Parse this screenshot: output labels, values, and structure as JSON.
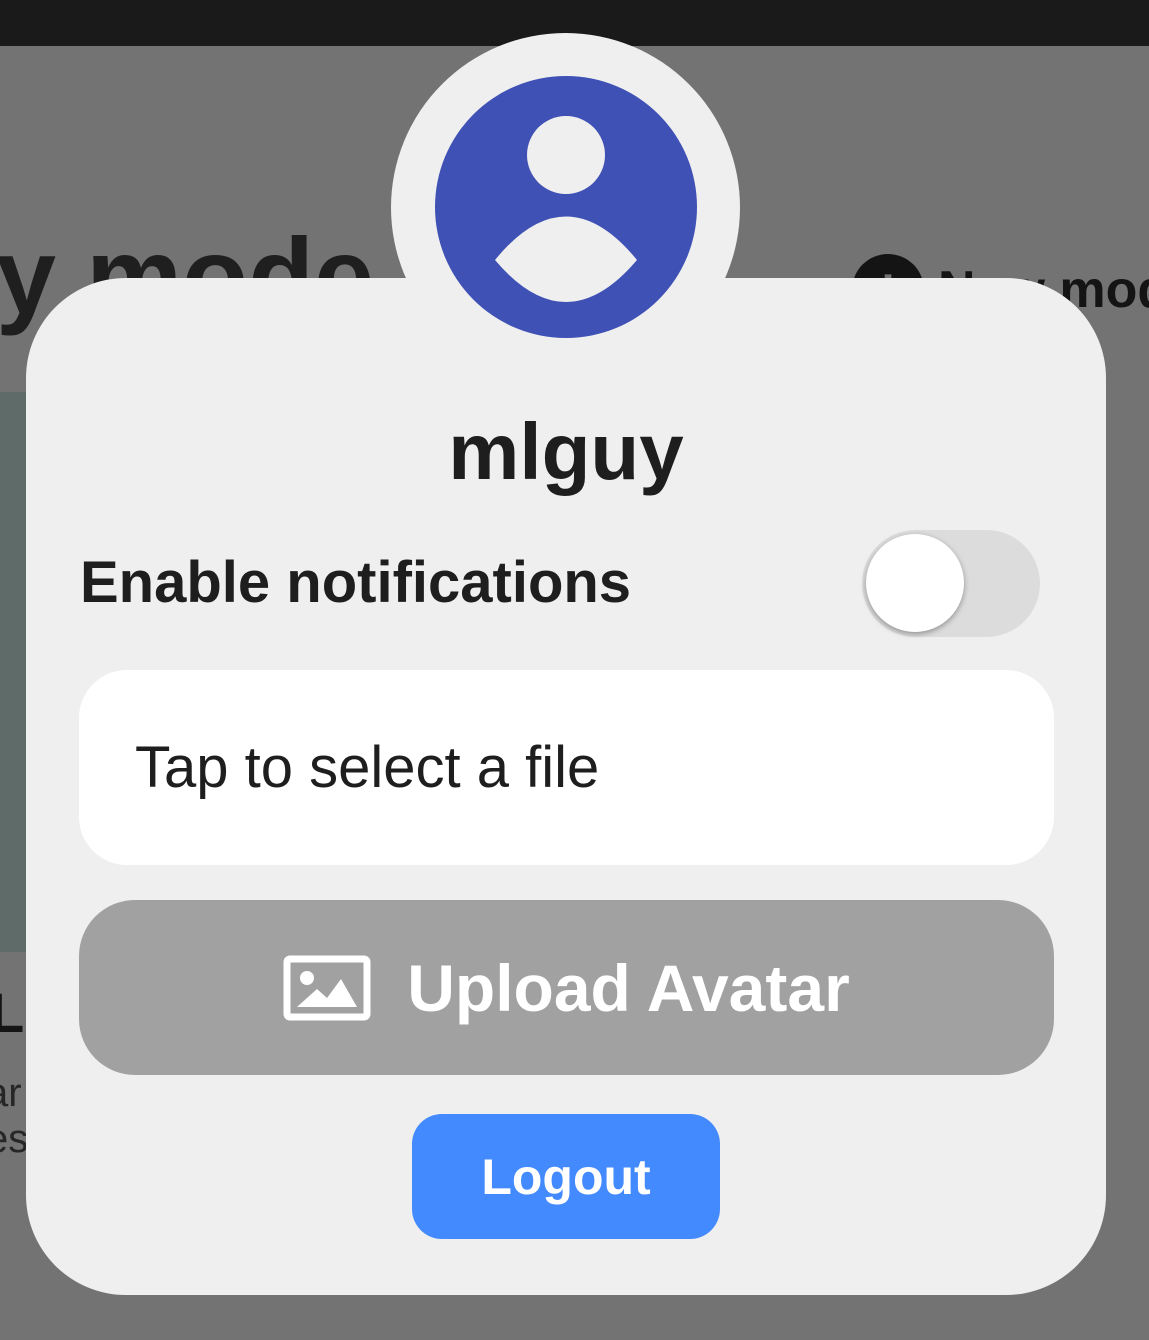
{
  "background": {
    "heading_text": "ly mode",
    "new_button_icon": "plus-icon",
    "new_button_label": "New mod",
    "card_title": "L",
    "card_description": "ar\nes"
  },
  "dialog": {
    "avatar_icon": "account-circle-icon",
    "username": "mlguy",
    "notifications": {
      "label": "Enable notifications",
      "enabled": false
    },
    "file_picker": {
      "placeholder": "Tap to select a file"
    },
    "upload_button": {
      "icon": "image-icon",
      "label": "Upload Avatar"
    },
    "logout_button": {
      "label": "Logout"
    }
  },
  "colors": {
    "avatar": "#3f51b5",
    "logout": "#448aff",
    "upload_disabled": "#a1a1a1",
    "dialog_bg": "#efefef",
    "scrim": "#737373"
  }
}
